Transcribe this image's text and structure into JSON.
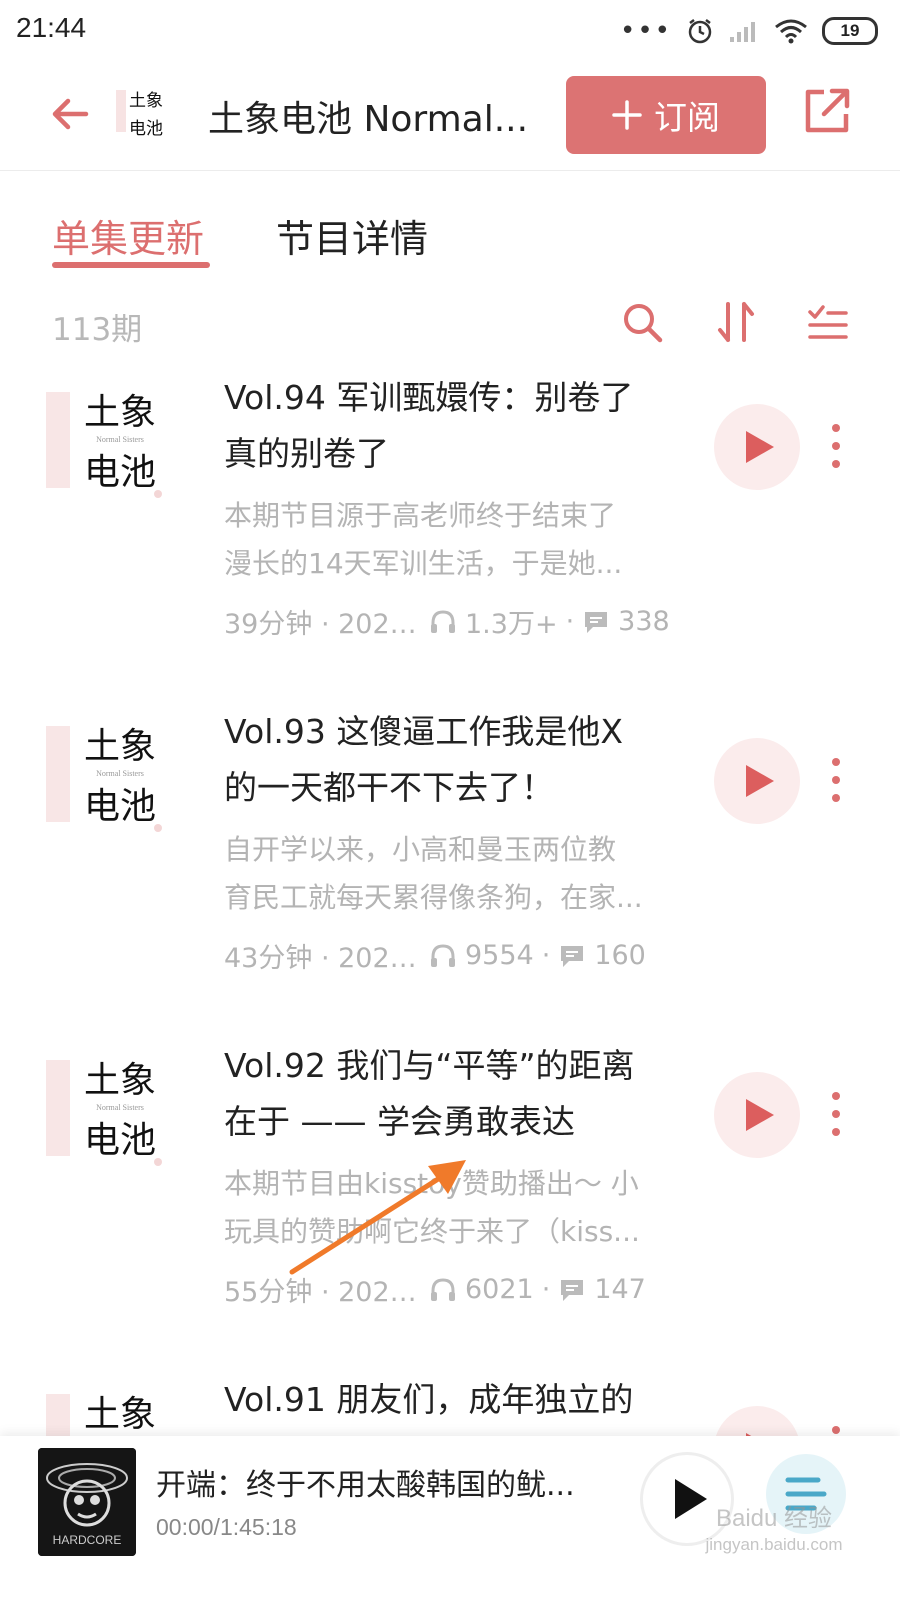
{
  "status_bar": {
    "time": "21:44",
    "dots": "•••",
    "battery": "19"
  },
  "header": {
    "title": "土象电池 Normal...",
    "logo_text": "土象电池",
    "subscribe_label": "订阅"
  },
  "tabs": [
    {
      "label": "单集更新",
      "active": true
    },
    {
      "label": "节目详情",
      "active": false
    }
  ],
  "list": {
    "count": "113期"
  },
  "episodes": [
    {
      "title_line1": "Vol.94 军训甄嬛传：别卷了",
      "title_line2": "真的别卷了",
      "desc_line1": "本期节目源于高老师终于结束了",
      "desc_line2": "漫长的14天军训生活，于是她...",
      "duration_date": "39分钟 · 2022...",
      "plays": "1.3万+",
      "comments": "338"
    },
    {
      "title_line1": "Vol.93 这傻逼工作我是他X",
      "title_line2": "的一天都干不下去了！",
      "desc_line1": "自开学以来，小高和曼玉两位教",
      "desc_line2": "育民工就每天累得像条狗，在家...",
      "duration_date": "43分钟 · 2022/...",
      "plays": "9554",
      "comments": "160"
    },
    {
      "title_line1": "Vol.92 我们与“平等”的距离",
      "title_line2": "在于 —— 学会勇敢表达",
      "desc_line1": "本期节目由kisstoy赞助播出～ 小",
      "desc_line2": "玩具的赞助啊它终于来了（kiss...",
      "duration_date": "55分钟 · 2022/...",
      "plays": "6021",
      "comments": "147"
    },
    {
      "title_line1": "Vol.91 朋友们，成年独立的",
      "title_line2": "",
      "desc_line1": "",
      "desc_line2": "",
      "duration_date": "",
      "plays": "",
      "comments": ""
    }
  ],
  "player": {
    "title": "开端：终于不用太酸韩国的鱿...",
    "time": "00:00/1:45:18",
    "cover_text": "HARDCORE"
  },
  "watermark": {
    "line1": "Baidu 经验",
    "line2": "jingyan.baidu.com"
  },
  "colors": {
    "accent": "#dc7373",
    "text_gray": "#b4b4b4",
    "annotation_arrow": "#f07a2a"
  }
}
